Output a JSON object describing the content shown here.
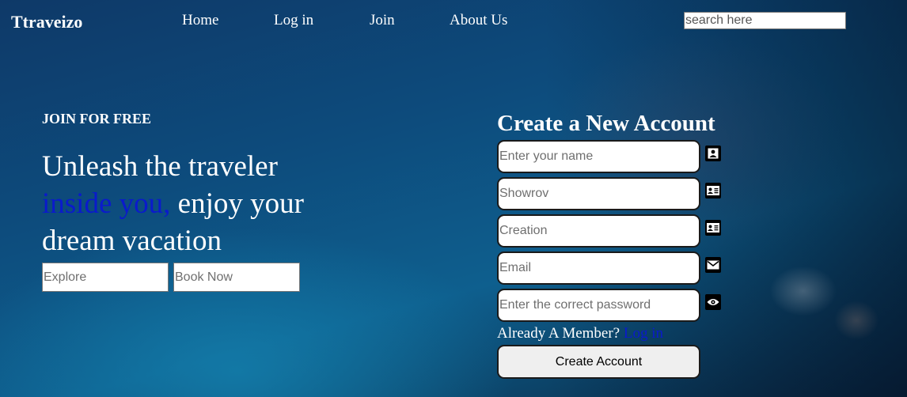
{
  "header": {
    "logo": "Ttraveizo",
    "nav": [
      "Home",
      "Log in",
      "Join",
      "About Us"
    ],
    "search_placeholder": "search here"
  },
  "hero": {
    "eyebrow": "JOIN FOR FREE",
    "headline_part1": "Unleash the traveler",
    "headline_accent": "inside you,",
    "headline_part2": "enjoy your dream vacation",
    "explore_placeholder": "Explore",
    "book_placeholder": "Book Now"
  },
  "form": {
    "title": "Create a New Account",
    "fields": [
      {
        "placeholder": "Enter your name",
        "icon": "contact-icon"
      },
      {
        "placeholder": "Showrov",
        "icon": "id-card-icon"
      },
      {
        "placeholder": "Creation",
        "icon": "id-card-icon"
      },
      {
        "placeholder": "Email",
        "icon": "envelope-icon"
      },
      {
        "placeholder": "Enter the correct password",
        "icon": "eye-icon"
      }
    ],
    "member_text": "Already A Member?",
    "login_link": "Log in",
    "submit_label": "Create Account"
  },
  "colors": {
    "accent": "#0a1acc"
  }
}
